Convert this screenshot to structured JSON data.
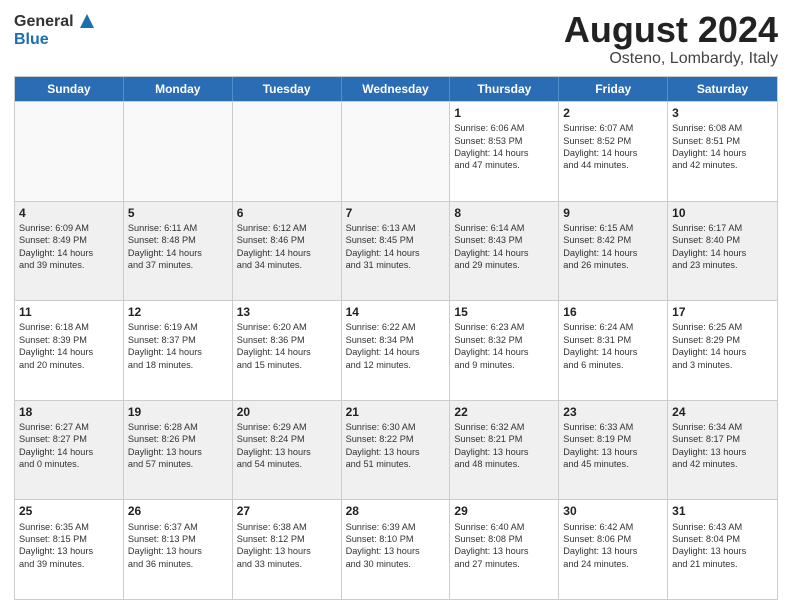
{
  "header": {
    "logo_general": "General",
    "logo_blue": "Blue",
    "month_title": "August 2024",
    "location": "Osteno, Lombardy, Italy"
  },
  "days_of_week": [
    "Sunday",
    "Monday",
    "Tuesday",
    "Wednesday",
    "Thursday",
    "Friday",
    "Saturday"
  ],
  "rows": [
    [
      {
        "day": "",
        "info": "",
        "empty": true
      },
      {
        "day": "",
        "info": "",
        "empty": true
      },
      {
        "day": "",
        "info": "",
        "empty": true
      },
      {
        "day": "",
        "info": "",
        "empty": true
      },
      {
        "day": "1",
        "info": "Sunrise: 6:06 AM\nSunset: 8:53 PM\nDaylight: 14 hours\nand 47 minutes."
      },
      {
        "day": "2",
        "info": "Sunrise: 6:07 AM\nSunset: 8:52 PM\nDaylight: 14 hours\nand 44 minutes."
      },
      {
        "day": "3",
        "info": "Sunrise: 6:08 AM\nSunset: 8:51 PM\nDaylight: 14 hours\nand 42 minutes."
      }
    ],
    [
      {
        "day": "4",
        "info": "Sunrise: 6:09 AM\nSunset: 8:49 PM\nDaylight: 14 hours\nand 39 minutes."
      },
      {
        "day": "5",
        "info": "Sunrise: 6:11 AM\nSunset: 8:48 PM\nDaylight: 14 hours\nand 37 minutes."
      },
      {
        "day": "6",
        "info": "Sunrise: 6:12 AM\nSunset: 8:46 PM\nDaylight: 14 hours\nand 34 minutes."
      },
      {
        "day": "7",
        "info": "Sunrise: 6:13 AM\nSunset: 8:45 PM\nDaylight: 14 hours\nand 31 minutes."
      },
      {
        "day": "8",
        "info": "Sunrise: 6:14 AM\nSunset: 8:43 PM\nDaylight: 14 hours\nand 29 minutes."
      },
      {
        "day": "9",
        "info": "Sunrise: 6:15 AM\nSunset: 8:42 PM\nDaylight: 14 hours\nand 26 minutes."
      },
      {
        "day": "10",
        "info": "Sunrise: 6:17 AM\nSunset: 8:40 PM\nDaylight: 14 hours\nand 23 minutes."
      }
    ],
    [
      {
        "day": "11",
        "info": "Sunrise: 6:18 AM\nSunset: 8:39 PM\nDaylight: 14 hours\nand 20 minutes."
      },
      {
        "day": "12",
        "info": "Sunrise: 6:19 AM\nSunset: 8:37 PM\nDaylight: 14 hours\nand 18 minutes."
      },
      {
        "day": "13",
        "info": "Sunrise: 6:20 AM\nSunset: 8:36 PM\nDaylight: 14 hours\nand 15 minutes."
      },
      {
        "day": "14",
        "info": "Sunrise: 6:22 AM\nSunset: 8:34 PM\nDaylight: 14 hours\nand 12 minutes."
      },
      {
        "day": "15",
        "info": "Sunrise: 6:23 AM\nSunset: 8:32 PM\nDaylight: 14 hours\nand 9 minutes."
      },
      {
        "day": "16",
        "info": "Sunrise: 6:24 AM\nSunset: 8:31 PM\nDaylight: 14 hours\nand 6 minutes."
      },
      {
        "day": "17",
        "info": "Sunrise: 6:25 AM\nSunset: 8:29 PM\nDaylight: 14 hours\nand 3 minutes."
      }
    ],
    [
      {
        "day": "18",
        "info": "Sunrise: 6:27 AM\nSunset: 8:27 PM\nDaylight: 14 hours\nand 0 minutes."
      },
      {
        "day": "19",
        "info": "Sunrise: 6:28 AM\nSunset: 8:26 PM\nDaylight: 13 hours\nand 57 minutes."
      },
      {
        "day": "20",
        "info": "Sunrise: 6:29 AM\nSunset: 8:24 PM\nDaylight: 13 hours\nand 54 minutes."
      },
      {
        "day": "21",
        "info": "Sunrise: 6:30 AM\nSunset: 8:22 PM\nDaylight: 13 hours\nand 51 minutes."
      },
      {
        "day": "22",
        "info": "Sunrise: 6:32 AM\nSunset: 8:21 PM\nDaylight: 13 hours\nand 48 minutes."
      },
      {
        "day": "23",
        "info": "Sunrise: 6:33 AM\nSunset: 8:19 PM\nDaylight: 13 hours\nand 45 minutes."
      },
      {
        "day": "24",
        "info": "Sunrise: 6:34 AM\nSunset: 8:17 PM\nDaylight: 13 hours\nand 42 minutes."
      }
    ],
    [
      {
        "day": "25",
        "info": "Sunrise: 6:35 AM\nSunset: 8:15 PM\nDaylight: 13 hours\nand 39 minutes."
      },
      {
        "day": "26",
        "info": "Sunrise: 6:37 AM\nSunset: 8:13 PM\nDaylight: 13 hours\nand 36 minutes."
      },
      {
        "day": "27",
        "info": "Sunrise: 6:38 AM\nSunset: 8:12 PM\nDaylight: 13 hours\nand 33 minutes."
      },
      {
        "day": "28",
        "info": "Sunrise: 6:39 AM\nSunset: 8:10 PM\nDaylight: 13 hours\nand 30 minutes."
      },
      {
        "day": "29",
        "info": "Sunrise: 6:40 AM\nSunset: 8:08 PM\nDaylight: 13 hours\nand 27 minutes."
      },
      {
        "day": "30",
        "info": "Sunrise: 6:42 AM\nSunset: 8:06 PM\nDaylight: 13 hours\nand 24 minutes."
      },
      {
        "day": "31",
        "info": "Sunrise: 6:43 AM\nSunset: 8:04 PM\nDaylight: 13 hours\nand 21 minutes."
      }
    ]
  ]
}
